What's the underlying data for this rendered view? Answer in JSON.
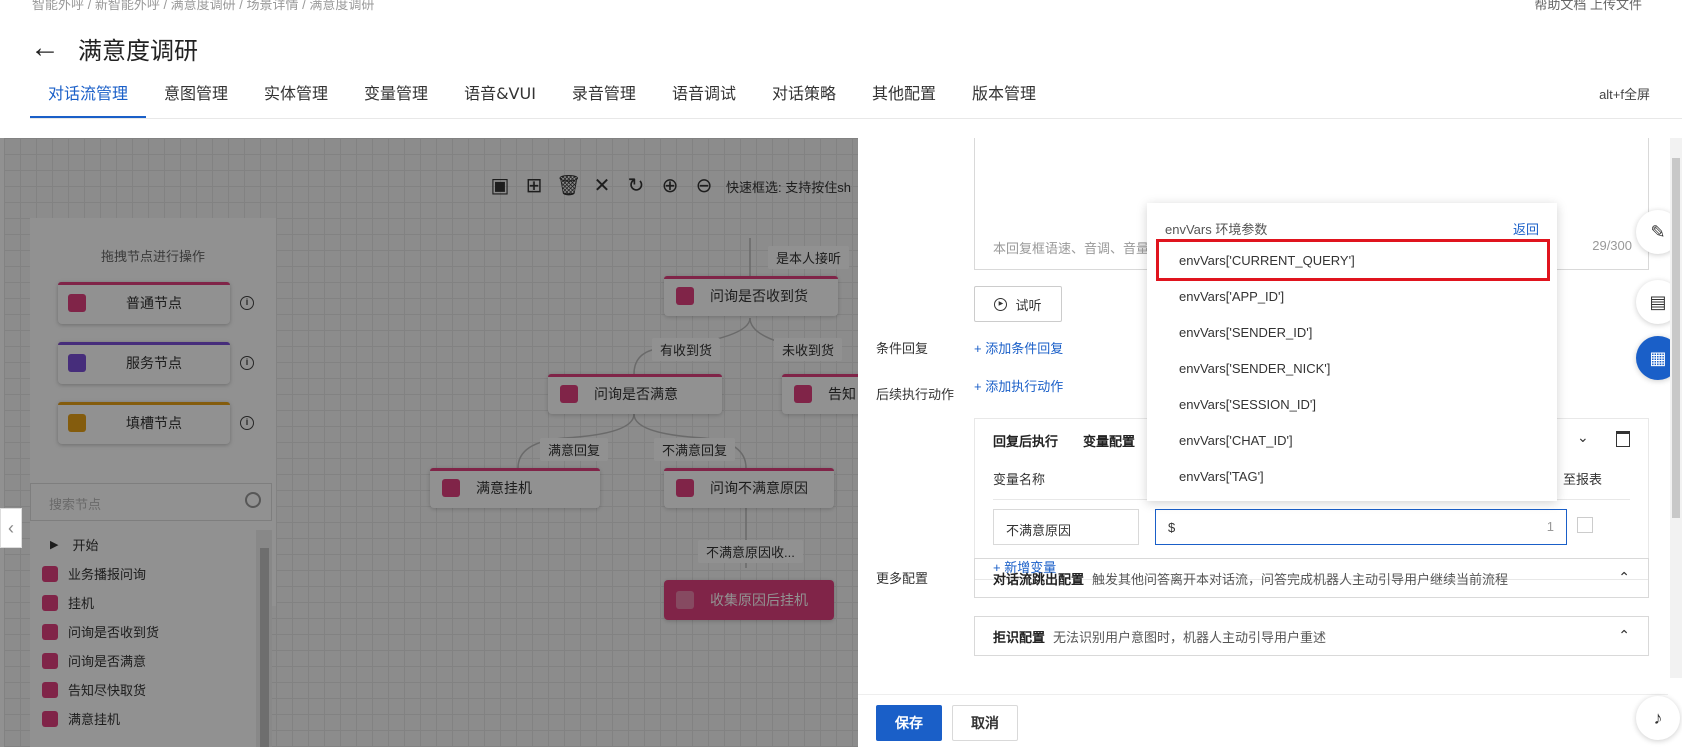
{
  "header": {
    "breadcrumb": "智能外呼 / 新智能外呼 / 满意度调研 / 场景详情 / 满意度调研",
    "top_right": "帮助文档   上传文件",
    "title": "满意度调研",
    "fullscreen_hint": "alt+f全屏",
    "tabs": [
      {
        "label": "对话流管理",
        "active": true
      },
      {
        "label": "意图管理"
      },
      {
        "label": "实体管理"
      },
      {
        "label": "变量管理"
      },
      {
        "label": "语音&VUI"
      },
      {
        "label": "录音管理"
      },
      {
        "label": "语音调试"
      },
      {
        "label": "对话策略"
      },
      {
        "label": "其他配置"
      },
      {
        "label": "版本管理"
      }
    ]
  },
  "canvas": {
    "toolbar_hint": "快速框选: 支持按住sh",
    "palette": {
      "hint": "拖拽节点进行操作",
      "nodes": [
        {
          "label": "普通节点",
          "color": "#e2407f"
        },
        {
          "label": "服务节点",
          "color": "#7b4fd8"
        },
        {
          "label": "填槽节点",
          "color": "#e8a317"
        }
      ],
      "search_placeholder": "搜索节点"
    },
    "tree": {
      "root": "开始",
      "items": [
        "业务播报问询",
        "挂机",
        "问询是否收到货",
        "问询是否满意",
        "告知尽快取货",
        "满意挂机"
      ]
    },
    "flow": {
      "nodes": [
        "问询是否收到货",
        "问询是否满意",
        "告知",
        "满意挂机",
        "问询不满意原因",
        "收集原因后挂机"
      ],
      "edges": [
        "是本人接听",
        "有收到货",
        "未收到货",
        "满意回复",
        "不满意回复",
        "不满意原因收..."
      ]
    }
  },
  "panel": {
    "textarea_hint": "本回复框语速、音调、音量",
    "counter": "29/300",
    "listen_label": "试听",
    "condition_label": "条件回复",
    "condition_add": "+ 添加条件回复",
    "action_label": "后续执行动作",
    "action_add": "+ 添加执行动作",
    "action_tab1": "回复后执行",
    "action_tab2": "变量配置",
    "var_name_header": "变量名称",
    "report_header": "至报表",
    "var_name_value": "不满意原因",
    "var_value_input": "$",
    "var_value_count": "1",
    "add_var": "+ 新增变量",
    "more_label": "更多配置",
    "cfg1_title": "对话流跳出配置",
    "cfg1_desc": "触发其他问答离开本对话流，问答完成机器人主动引导用户继续当前流程",
    "cfg2_title": "拒识配置",
    "cfg2_desc": "无法识别用户意图时，机器人主动引导用户重述",
    "save": "保存",
    "cancel": "取消"
  },
  "dropdown": {
    "title": "envVars 环境参数",
    "back": "返回",
    "items": [
      "envVars['CURRENT_QUERY']",
      "envVars['APP_ID']",
      "envVars['SENDER_ID']",
      "envVars['SENDER_NICK']",
      "envVars['SESSION_ID']",
      "envVars['CHAT_ID']",
      "envVars['TAG']"
    ]
  },
  "accent": "#1a5fc8",
  "highlight": "#e0141e"
}
